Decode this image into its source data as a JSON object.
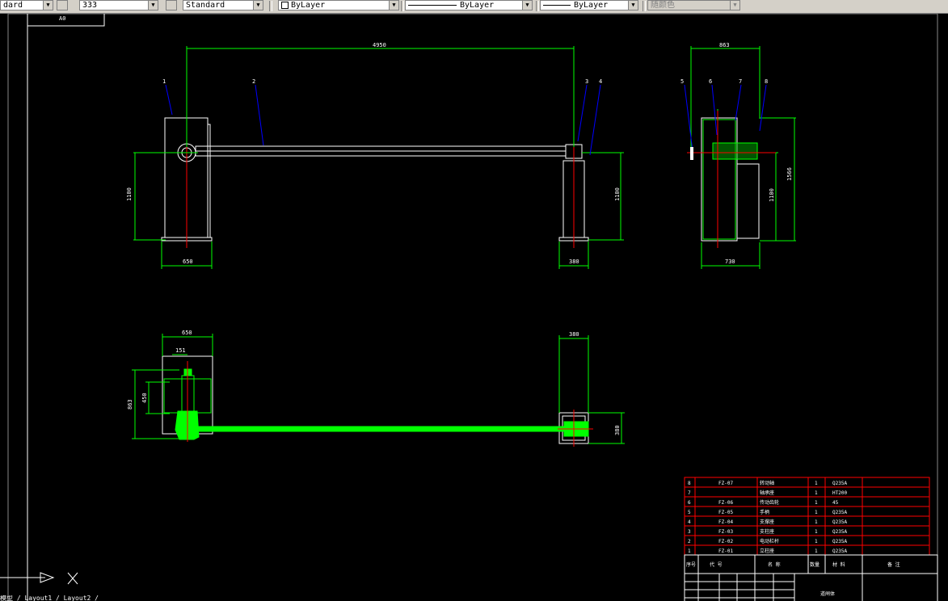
{
  "toolbar": {
    "text_style": "dard",
    "dim_value": "333",
    "dim_style": "Standard",
    "layer": "ByLayer",
    "linetype": "ByLayer",
    "lineweight": "ByLayer",
    "color": "随颜色"
  },
  "drawing": {
    "title_tab": "A0",
    "dimensions": {
      "top_span": "4950",
      "side_width": "863",
      "left_height": "1100",
      "right_height": "1100",
      "side_height_a": "1100",
      "side_height_b": "1566",
      "left_base": "650",
      "right_base": "380",
      "side_base": "730",
      "plan_width": "650",
      "plan_inner": "151",
      "plan_depth": "863",
      "plan_inner_depth": "450",
      "plan_right_width": "380",
      "plan_right_depth": "380"
    },
    "balloons": [
      "1",
      "2",
      "3",
      "4",
      "5",
      "6",
      "7",
      "8"
    ]
  },
  "parts_list": {
    "rows": [
      {
        "no": "8",
        "code": "FZ-07",
        "name": "转动轴",
        "qty": "1",
        "material": "Q235A"
      },
      {
        "no": "7",
        "code": "",
        "name": "轴承座",
        "qty": "1",
        "material": "HT200"
      },
      {
        "no": "6",
        "code": "FZ-06",
        "name": "传动齿轮",
        "qty": "1",
        "material": "45"
      },
      {
        "no": "5",
        "code": "FZ-05",
        "name": "手柄",
        "qty": "1",
        "material": "Q235A"
      },
      {
        "no": "4",
        "code": "FZ-04",
        "name": "支撑座",
        "qty": "1",
        "material": "Q235A"
      },
      {
        "no": "3",
        "code": "FZ-03",
        "name": "支柱座",
        "qty": "1",
        "material": "Q235A"
      },
      {
        "no": "2",
        "code": "FZ-02",
        "name": "电动栏杆",
        "qty": "1",
        "material": "Q235A"
      },
      {
        "no": "1",
        "code": "FZ-01",
        "name": "立柱座",
        "qty": "1",
        "material": "Q235A"
      }
    ],
    "header": {
      "no": "序号",
      "code": "代 号",
      "name": "名 称",
      "qty": "数量",
      "material": "材 料",
      "note": "备 注"
    },
    "title_label": "道闸体"
  },
  "command": {
    "text": "模型 / Layout1 / Layout2 /"
  },
  "colors": {
    "dim": "#00ff00",
    "outline": "#ffffff",
    "center": "#ff0000",
    "leader": "#0000ff",
    "table": "#ff0000"
  }
}
